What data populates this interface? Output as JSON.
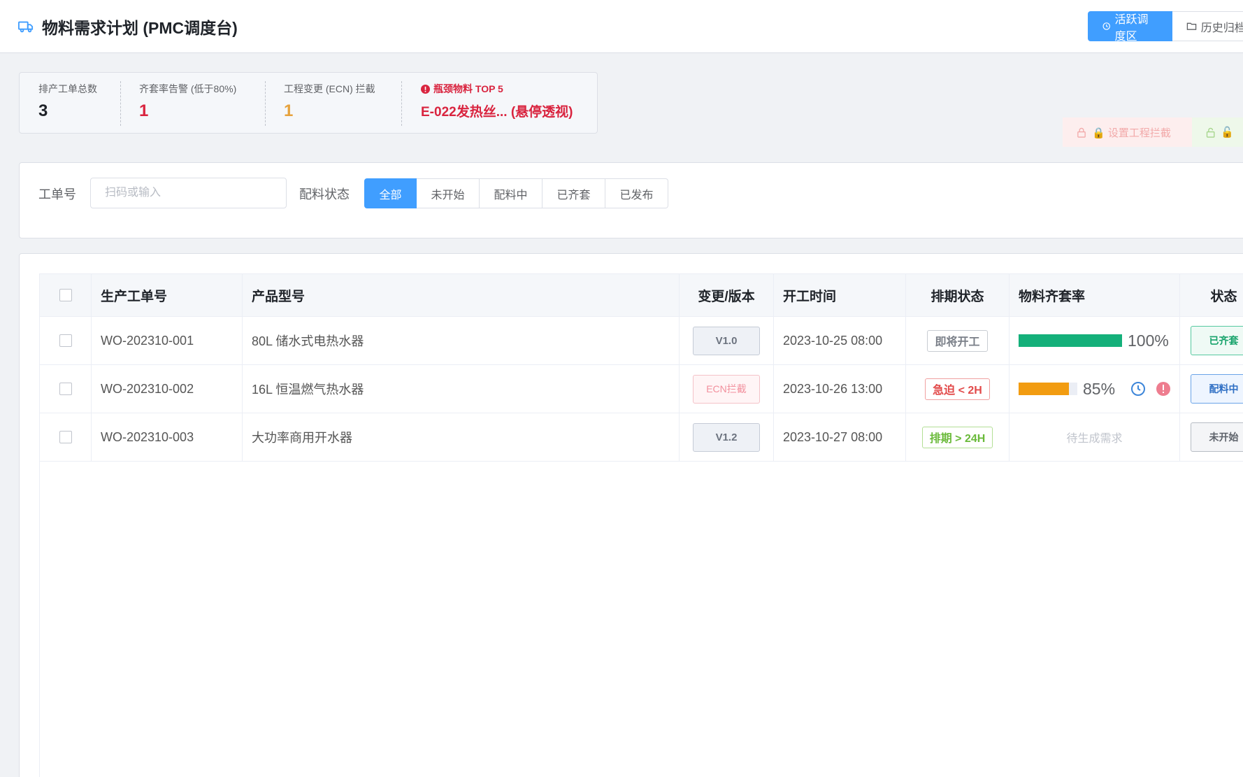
{
  "header": {
    "title": "物料需求计划 (PMC调度台)",
    "tabs": [
      {
        "label": "活跃调度区",
        "active": true
      },
      {
        "label": "历史归档区",
        "active": false
      }
    ]
  },
  "stats": {
    "total_orders": {
      "label": "排产工单总数",
      "value": "3"
    },
    "kit_rate_alert": {
      "label": "齐套率告警 (低于80%)",
      "value": "1"
    },
    "ecn_block": {
      "label": "工程变更 (ECN) 拦截",
      "value": "1"
    },
    "bottleneck": {
      "label": "瓶颈物料 TOP 5",
      "value": "E-022发热丝... (悬停透视)"
    }
  },
  "lock_actions": {
    "set_block": "🔒 设置工程拦截",
    "release_block": "🔓"
  },
  "filter": {
    "order_label": "工单号",
    "order_placeholder": "扫码或输入",
    "status_label": "配料状态",
    "status_options": [
      "全部",
      "未开始",
      "配料中",
      "已齐套",
      "已发布"
    ],
    "status_selected": "全部"
  },
  "table": {
    "headers": {
      "order_no": "生产工单号",
      "model": "产品型号",
      "version": "变更/版本",
      "start": "开工时间",
      "schedule": "排期状态",
      "kit_rate": "物料齐套率",
      "status": "状态"
    },
    "rows": [
      {
        "order_no": "WO-202310-001",
        "model": "80L 储水式电热水器",
        "version": "V1.0",
        "version_type": "normal",
        "start": "2023-10-25 08:00",
        "schedule": "即将开工",
        "schedule_type": "gray",
        "kit_rate": 100,
        "kit_rate_text": "100%",
        "status": "已齐套",
        "status_type": "ok"
      },
      {
        "order_no": "WO-202310-002",
        "model": "16L 恒温燃气热水器",
        "version": "ECN拦截",
        "version_type": "ecn",
        "start": "2023-10-26 13:00",
        "schedule": "急迫 < 2H",
        "schedule_type": "red",
        "kit_rate": 85,
        "kit_rate_text": "85%",
        "status": "配料中",
        "status_type": "ing"
      },
      {
        "order_no": "WO-202310-003",
        "model": "大功率商用开水器",
        "version": "V1.2",
        "version_type": "normal",
        "start": "2023-10-27 08:00",
        "schedule": "排期 > 24H",
        "schedule_type": "green",
        "kit_rate_text": "待生成需求",
        "status": "未开始",
        "status_type": "no"
      }
    ]
  },
  "colors": {
    "primary": "#409eff",
    "danger": "#d9243f",
    "warning": "#e6a23c",
    "success": "#14b07a",
    "progress_warn": "#f29c11"
  }
}
